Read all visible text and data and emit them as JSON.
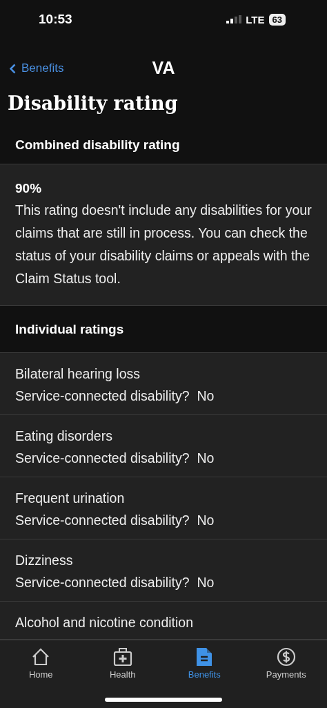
{
  "status_bar": {
    "time": "10:53",
    "network": "LTE",
    "battery": "63"
  },
  "nav": {
    "back_label": "Benefits",
    "title": "VA"
  },
  "page_title": "Disability rating",
  "combined": {
    "heading": "Combined disability rating",
    "rating": "90%",
    "description": "This rating doesn't include any disabilities for your claims that are still in process. You can check the status of your disability claims or appeals with the Claim Status tool."
  },
  "individual": {
    "heading": "Individual ratings",
    "rows": [
      {
        "name": "Bilateral hearing loss",
        "status_label": "Service-connected disability?",
        "status_value": "No"
      },
      {
        "name": "Eating disorders",
        "status_label": "Service-connected disability?",
        "status_value": "No"
      },
      {
        "name": "Frequent urination",
        "status_label": "Service-connected disability?",
        "status_value": "No"
      },
      {
        "name": "Dizziness",
        "status_label": "Service-connected disability?",
        "status_value": "No"
      },
      {
        "name": "Alcohol and nicotine condition"
      }
    ]
  },
  "tab_bar": [
    {
      "kind": "home",
      "label": "Home",
      "selected": false
    },
    {
      "kind": "health",
      "label": "Health",
      "selected": false
    },
    {
      "kind": "benefits",
      "label": "Benefits",
      "selected": true
    },
    {
      "kind": "payments",
      "label": "Payments",
      "selected": false
    }
  ]
}
